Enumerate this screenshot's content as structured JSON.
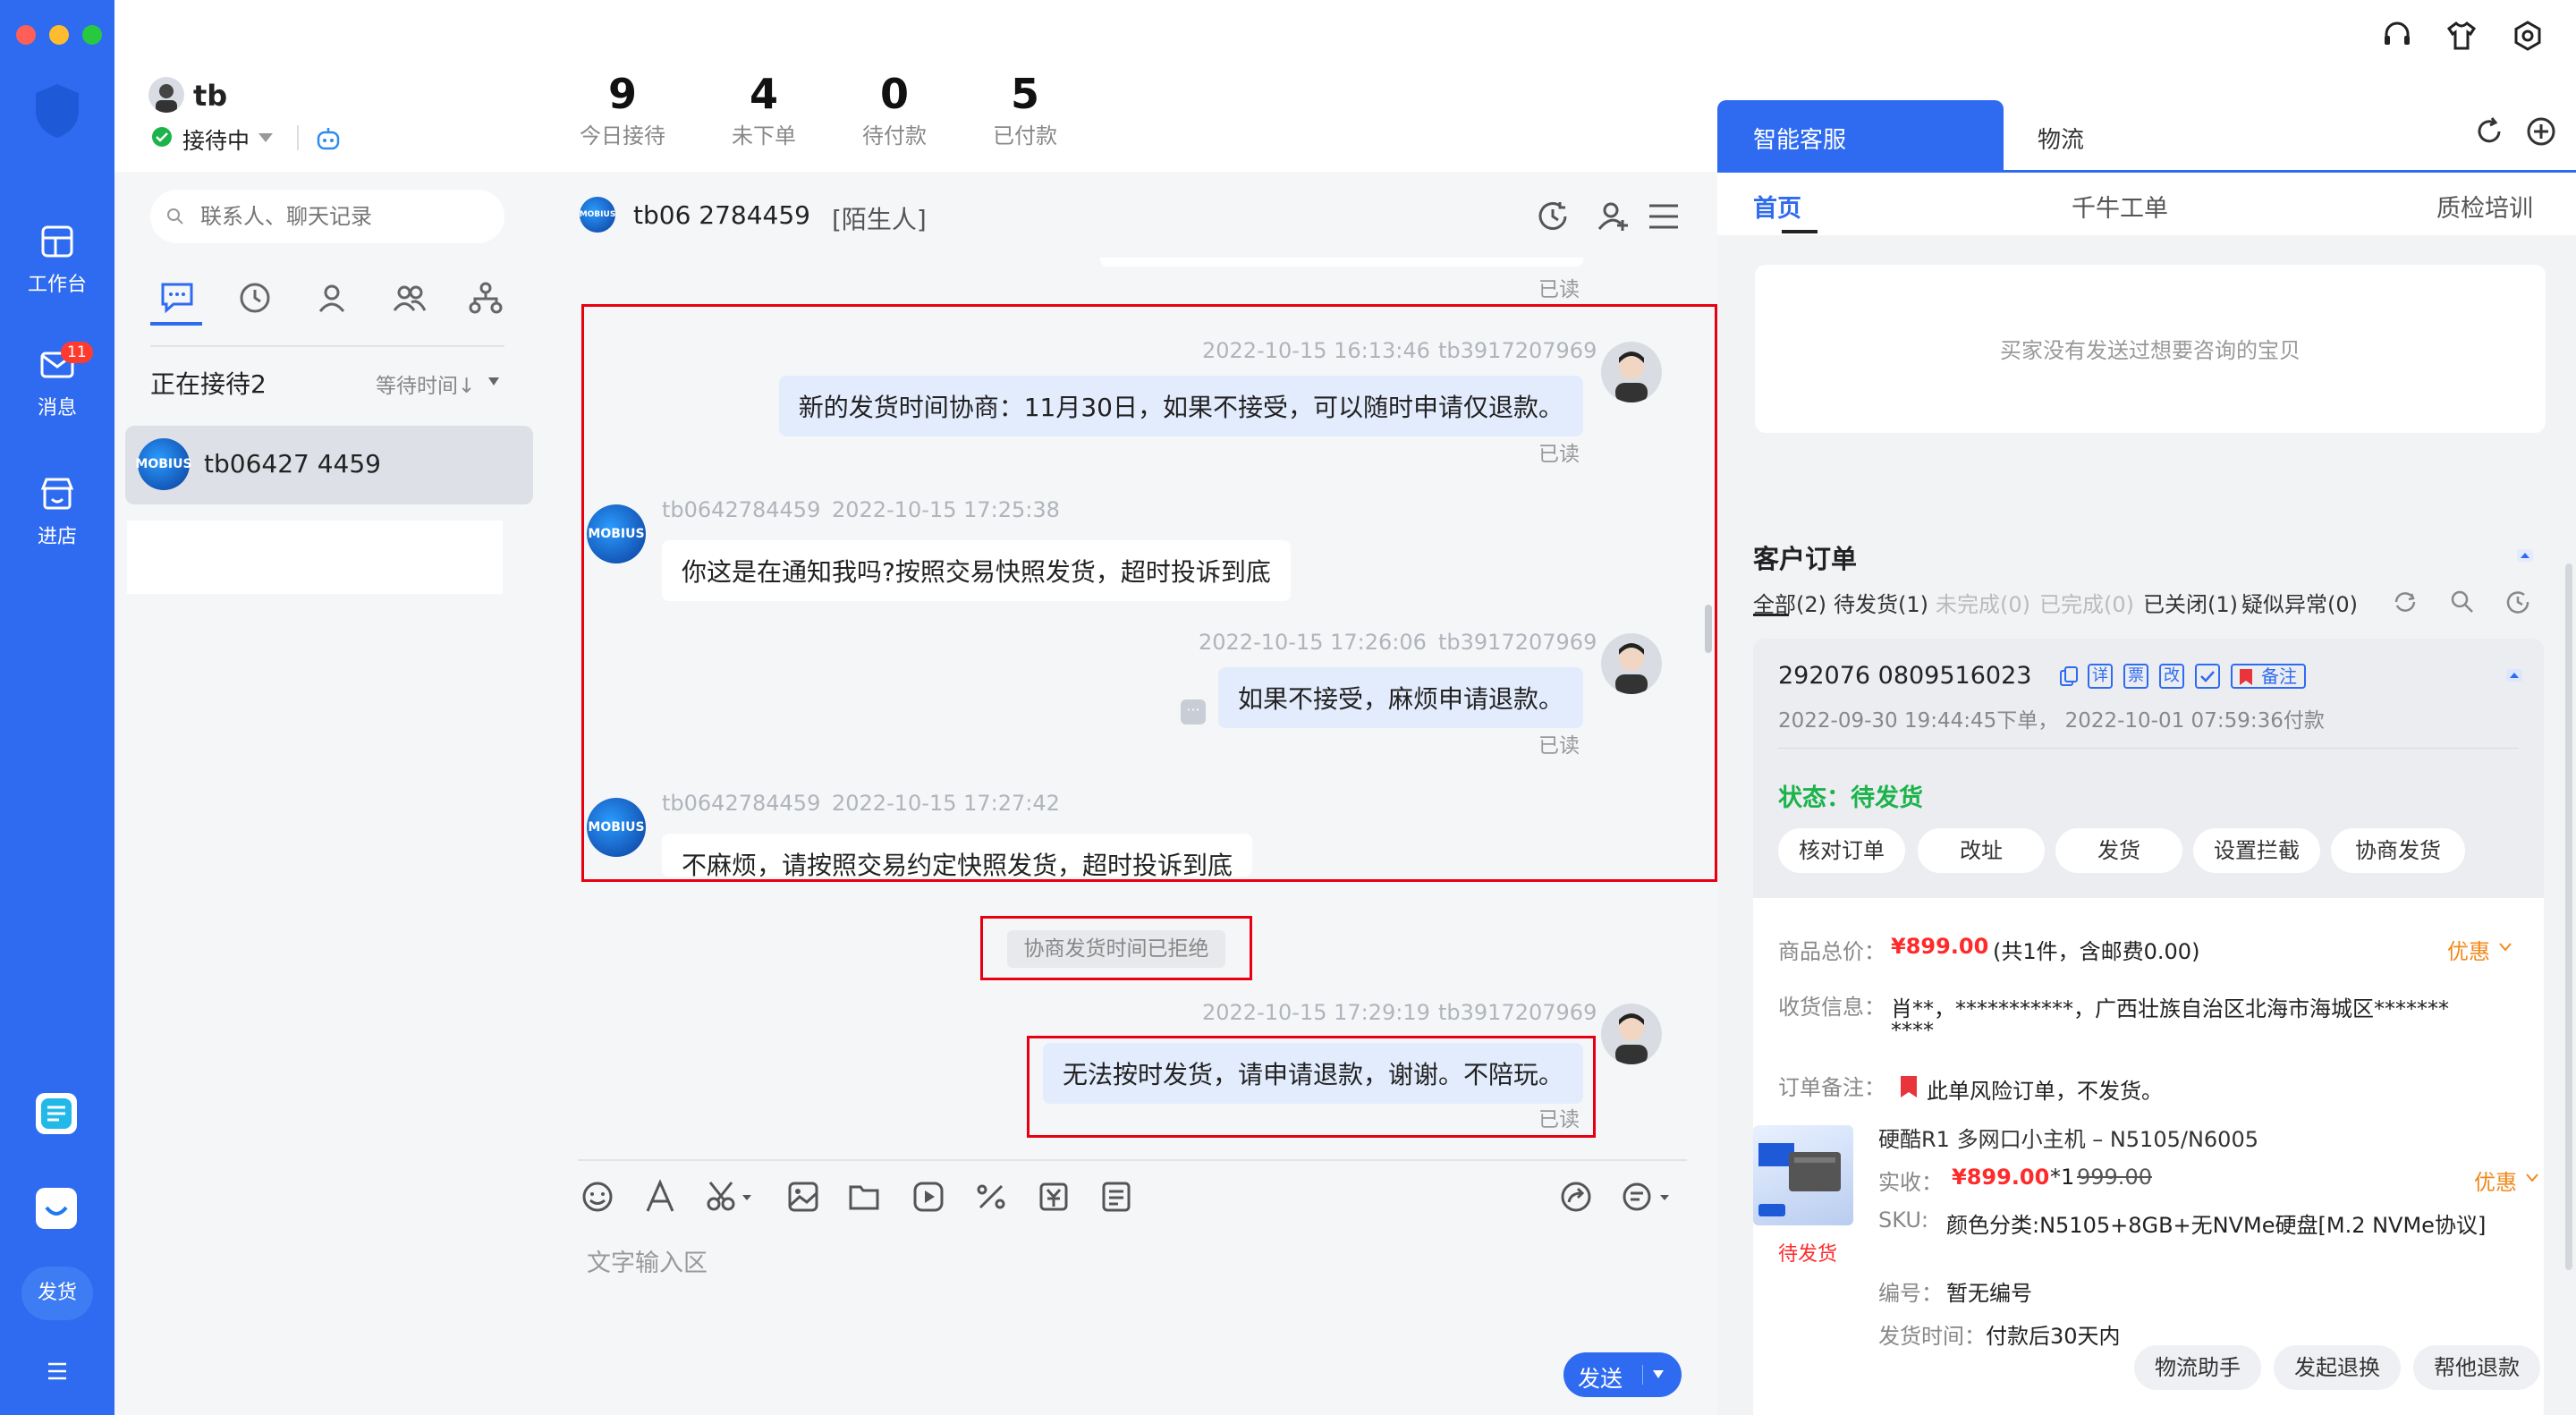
{
  "window": {
    "traffic_colors": [
      "#ff5f57",
      "#febc2e",
      "#28c840"
    ]
  },
  "rail": {
    "items": [
      {
        "label": "工作台",
        "icon": "workbench-icon"
      },
      {
        "label": "消息",
        "icon": "message-icon",
        "badge": "11"
      },
      {
        "label": "进店",
        "icon": "store-icon"
      }
    ],
    "bottom": {
      "ship_label": "发货"
    },
    "accent": "#2f6bf0"
  },
  "user": {
    "name": "tb",
    "status": "接待中"
  },
  "stats": [
    {
      "num": "9",
      "label": "今日接待"
    },
    {
      "num": "4",
      "label": "未下单"
    },
    {
      "num": "0",
      "label": "待付款"
    },
    {
      "num": "5",
      "label": "已付款"
    }
  ],
  "contacts": {
    "search_placeholder": "联系人、聊天记录",
    "section_title": "正在接待2",
    "sort_label": "等待时间↓",
    "items": [
      {
        "name": "tb06427 4459",
        "avatar_text": "MOBIUS"
      }
    ]
  },
  "chat": {
    "header_name": "tb06 2784459",
    "header_tag": "[陌生人]",
    "read_label": "已读",
    "messages": [
      {
        "dir": "out",
        "sender": "tb3917207969",
        "time": "2022-10-15 16:13:46",
        "text": "新的发货时间协商：11月30日，如果不接受，可以随时申请仅退款。"
      },
      {
        "dir": "in",
        "sender": "tb0642784459",
        "time": "2022-10-15 17:25:38",
        "text": "你这是在通知我吗?按照交易快照发货，超时投诉到底"
      },
      {
        "dir": "out",
        "sender": "tb3917207969",
        "time": "2022-10-15 17:26:06",
        "text": "如果不接受，麻烦申请退款。"
      },
      {
        "dir": "in",
        "sender": "tb0642784459",
        "time": "2022-10-15 17:27:42",
        "text": "不麻烦，请按照交易约定快照发货，超时投诉到底"
      },
      {
        "dir": "out",
        "sender": "tb3917207969",
        "time": "2022-10-15 17:29:19",
        "text": "无法按时发货，请申请退款，谢谢。不陪玩。"
      }
    ],
    "system_notice": "协商发货时间已拒绝",
    "input_placeholder": "文字输入区",
    "send_label": "发送"
  },
  "right": {
    "tabs": [
      "智能客服",
      "物流"
    ],
    "subtabs": [
      "首页",
      "千牛工单",
      "质检培训"
    ],
    "empty_goods": "买家没有发送过想要咨询的宝贝",
    "orders_title": "客户订单",
    "filters": [
      "全部(2)",
      "待发货(1)",
      "未完成(0)",
      "已完成(0)",
      "已关闭(1)",
      "疑似异常(0)"
    ],
    "order": {
      "id": "292076 0809516023",
      "tag_labels": [
        "详",
        "票",
        "改"
      ],
      "note_tag": "备注",
      "times": "2022-09-30 19:44:45下单，  2022-10-01 07:59:36付款",
      "status_label": "状态：",
      "status_value": "待发货",
      "actions": [
        "核对订单",
        "改址",
        "发货",
        "设置拦截",
        "协商发货"
      ],
      "total_label": "商品总价：",
      "total_value": "¥899.00",
      "total_note": "(共1件，含邮费0.00)",
      "discount_label": "优惠",
      "addr_label": "收货信息：",
      "addr_value": "肖**，***********，广西壮族自治区北海市海城区*******",
      "addr_value2": "****",
      "remark_label": "订单备注：",
      "remark_value": "此单风险订单，不发货。",
      "product_name": "硬酷R1 多网口小主机 – N5105/N6005",
      "paid_label": "实收：",
      "paid_value": "¥899.00",
      "qty": "*1",
      "orig_price": "999.00",
      "sku_label": "SKU:",
      "sku_value": "颜色分类:N5105+8GB+无NVMe硬盘[M.2 NVMe协议]",
      "product_status": "待发货",
      "code_label": "编号：",
      "code_value": "暂无编号",
      "ship_time_label": "发货时间：",
      "ship_time_value": "付款后30天内"
    },
    "bottom_buttons": [
      "物流助手",
      "发起退换",
      "帮他退款"
    ]
  }
}
